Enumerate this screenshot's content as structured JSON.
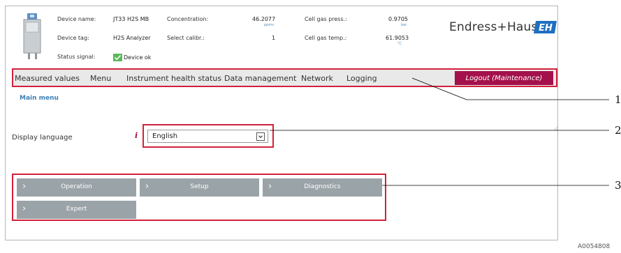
{
  "header": {
    "device_name_label": "Device name:",
    "device_name_value": "JT33 H2S MB",
    "device_tag_label": "Device tag:",
    "device_tag_value": "H2S Analyzer",
    "status_signal_label": "Status signal:",
    "status_signal_value": "Device ok",
    "concentration_label": "Concentration:",
    "concentration_value": "46.2077",
    "concentration_unit": "ppmv",
    "select_calibr_label": "Select calibr.:",
    "select_calibr_value": "1",
    "cell_gas_press_label": "Cell gas press.:",
    "cell_gas_press_value": "0.9705",
    "cell_gas_press_unit": "bar",
    "cell_gas_temp_label": "Cell gas temp.:",
    "cell_gas_temp_value": "61.9053",
    "cell_gas_temp_unit": "°C",
    "brand": "Endress+Hauser",
    "brand_logo_text": "EH"
  },
  "nav": {
    "items": [
      "Measured values",
      "Menu",
      "Instrument health status",
      "Data management",
      "Network",
      "Logging"
    ],
    "logout": "Logout (Maintenance)"
  },
  "main": {
    "title": "Main menu",
    "display_language_label": "Display language",
    "info_icon": "i",
    "language_value": "English",
    "buttons": [
      "Operation",
      "Setup",
      "Diagnostics",
      "Expert"
    ]
  },
  "callouts": [
    "1",
    "2",
    "3"
  ],
  "figure_id": "A0054808",
  "colors": {
    "accent_red": "#d3213b",
    "logout_bg": "#a4104b",
    "button_bg": "#9aa3a8",
    "nav_bg": "#e9e9e9",
    "title_blue": "#3b7fb5",
    "status_ok_green": "#5cb85c",
    "logo_blue": "#1f6fc1"
  },
  "icons": {
    "device": "analyzer-device-icon",
    "status": "checkmark-icon",
    "dropdown": "chevron-down-icon",
    "info": "info-icon",
    "button_chevron": "chevron-right-icon"
  }
}
